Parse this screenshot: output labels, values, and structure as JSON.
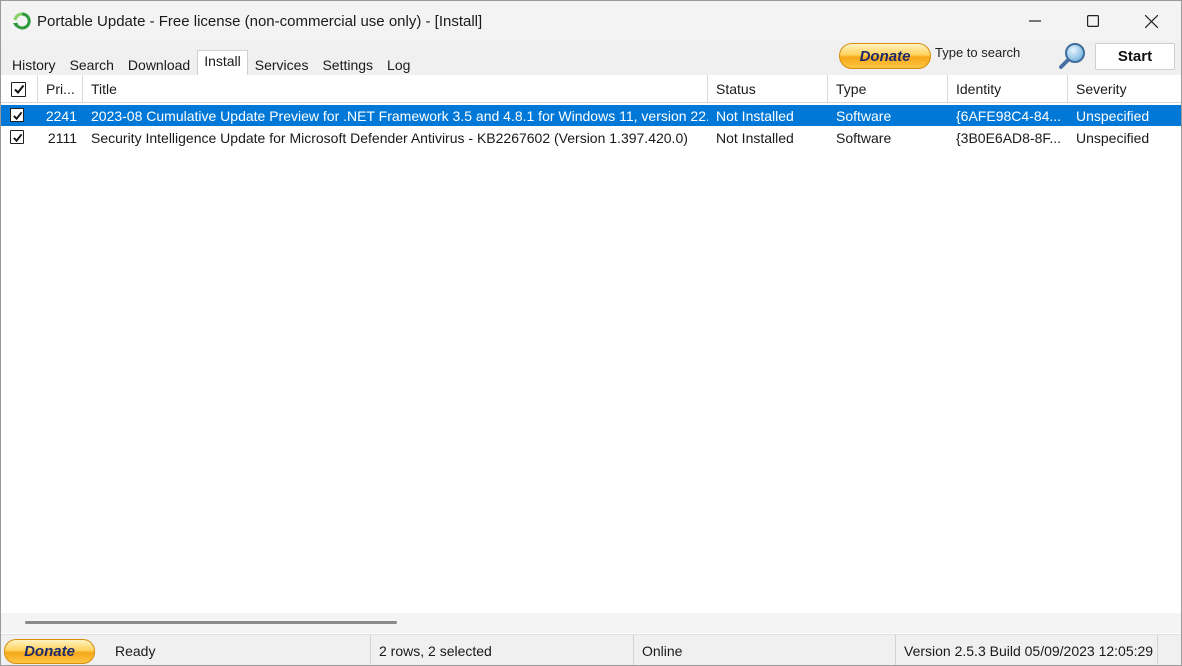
{
  "window": {
    "title": "Portable Update  - Free license (non-commercial use only) - [Install]"
  },
  "tabs": [
    {
      "label": "History"
    },
    {
      "label": "Search"
    },
    {
      "label": "Download"
    },
    {
      "label": "Install",
      "active": true
    },
    {
      "label": "Services"
    },
    {
      "label": "Settings"
    },
    {
      "label": "Log"
    }
  ],
  "toolbar": {
    "donate_label": "Donate",
    "search_placeholder": "Type to search",
    "start_label": "Start"
  },
  "columns": {
    "priority": "Pri...",
    "title": "Title",
    "status": "Status",
    "type": "Type",
    "identity": "Identity",
    "severity": "Severity"
  },
  "rows": [
    {
      "checked": true,
      "selected": true,
      "priority": "2241",
      "title": "2023-08 Cumulative Update Preview for .NET Framework 3.5 and 4.8.1 for Windows 11, version 22...",
      "status": "Not Installed",
      "type": "Software",
      "identity": "{6AFE98C4-84...",
      "severity": "Unspecified"
    },
    {
      "checked": true,
      "selected": false,
      "priority": "2111",
      "title": "Security Intelligence Update for Microsoft Defender Antivirus - KB2267602 (Version 1.397.420.0)",
      "status": "Not Installed",
      "type": "Software",
      "identity": "{3B0E6AD8-8F...",
      "severity": "Unspecified"
    }
  ],
  "statusbar": {
    "donate_label": "Donate",
    "state": "Ready",
    "selection": "2 rows, 2 selected",
    "connection": "Online",
    "version": "Version 2.5.3 Build 05/09/2023 12:05:29"
  },
  "colors": {
    "selection": "#0078d7",
    "donate_gold": "#ffc644",
    "donate_text": "#1e2b6b"
  }
}
